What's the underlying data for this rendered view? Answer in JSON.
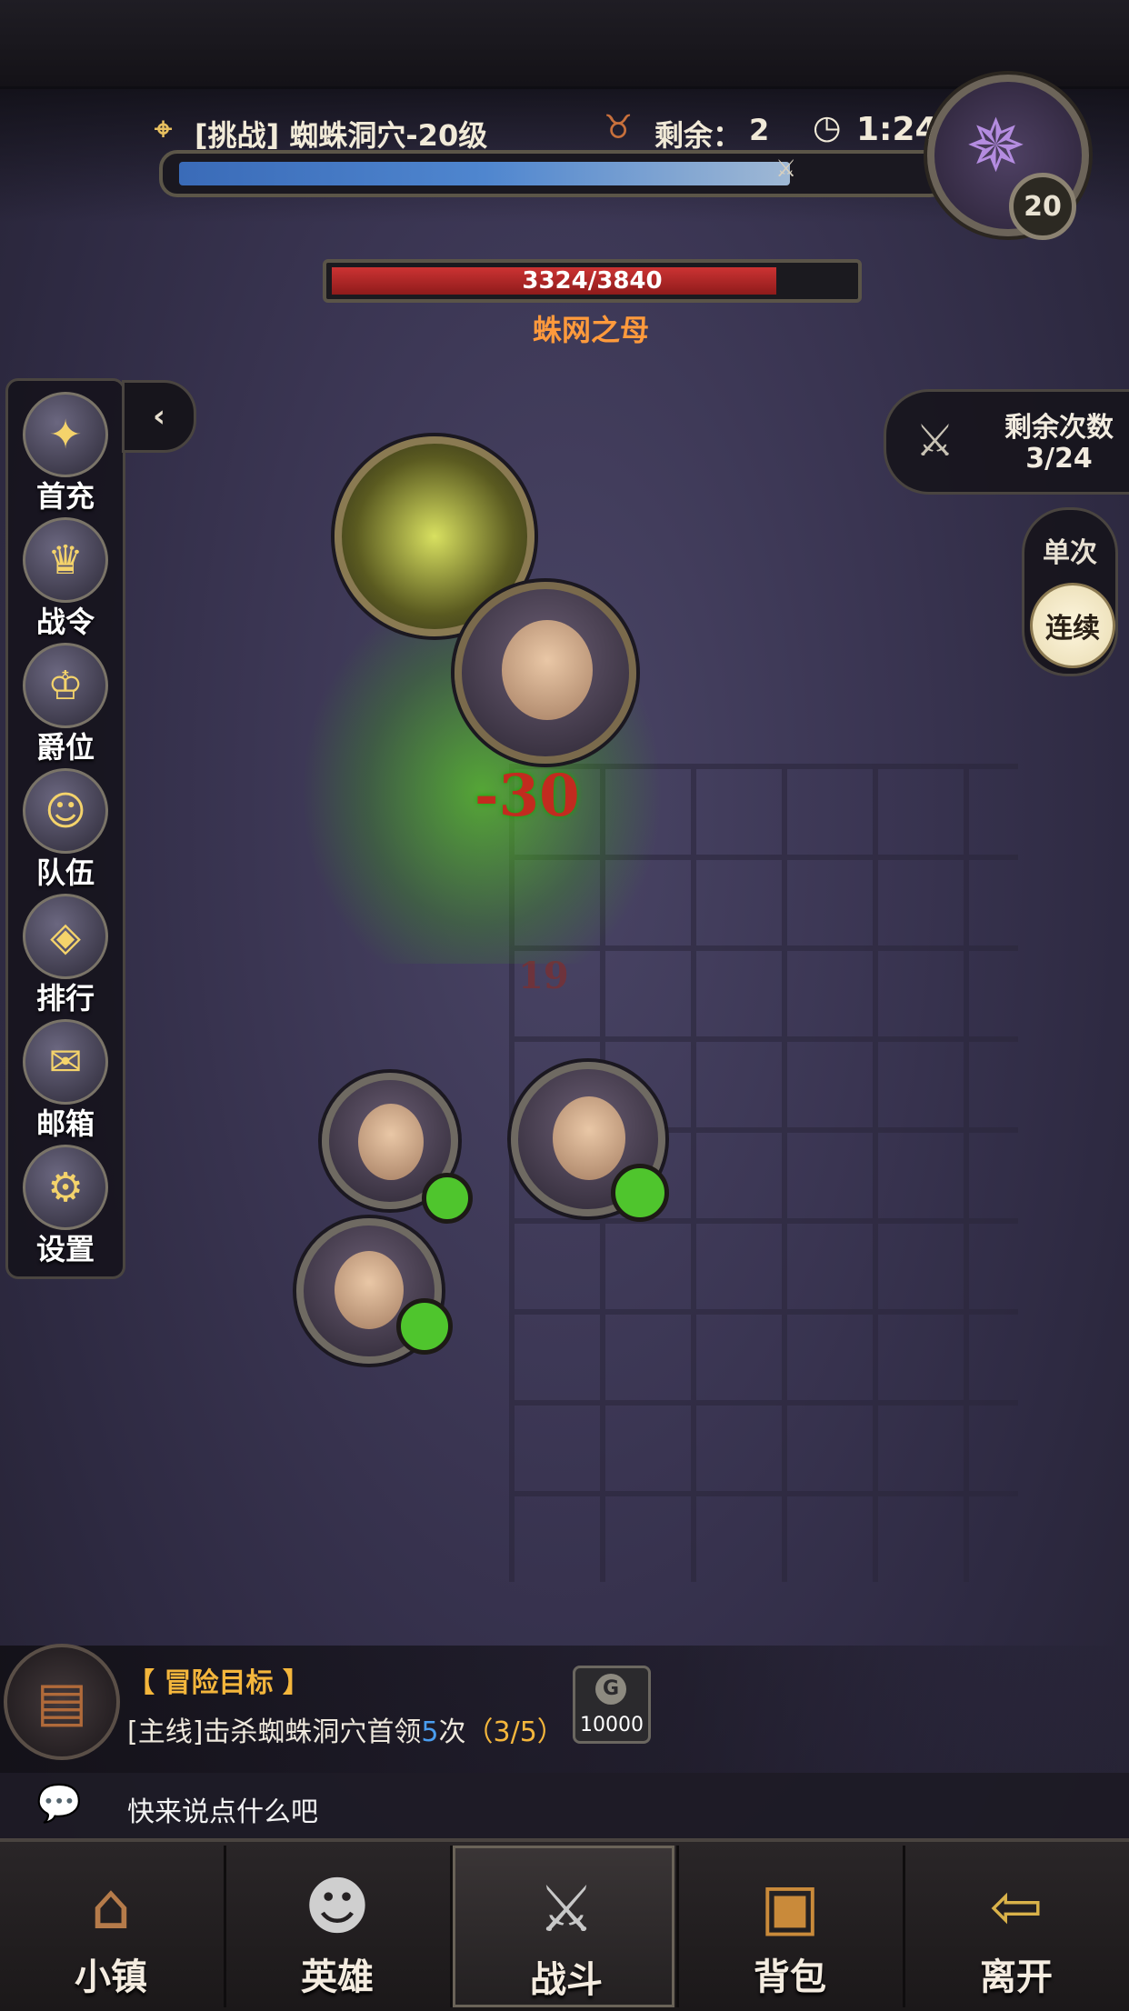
{
  "header": {
    "stage": "[挑战] 蜘蛛洞穴-20级",
    "remaining_label": "剩余：",
    "remaining_value": "2",
    "timer": "1:24",
    "progress_fraction": 0.82,
    "boss_level": "20"
  },
  "boss": {
    "hp_text": "3324/3840",
    "hp_current": 3324,
    "hp_max": 3840,
    "name": "蛛网之母"
  },
  "sidebar": {
    "collapse_icon": "chevron-left-icon",
    "items": [
      {
        "label": "首充",
        "icon": "treasure-chest-icon",
        "glyph": "✦"
      },
      {
        "label": "战令",
        "icon": "winged-crest-icon",
        "glyph": "♛"
      },
      {
        "label": "爵位",
        "icon": "crown-icon",
        "glyph": "♔"
      },
      {
        "label": "队伍",
        "icon": "team-faces-icon",
        "glyph": "☺"
      },
      {
        "label": "排行",
        "icon": "ranking-shield-icon",
        "glyph": "◈"
      },
      {
        "label": "邮箱",
        "icon": "mail-envelope-icon",
        "glyph": "✉"
      },
      {
        "label": "设置",
        "icon": "gear-icon",
        "glyph": "⚙"
      }
    ]
  },
  "right_panel": {
    "remain_times_label": "剩余次数",
    "remain_times_value": "3/24",
    "mode_single": "单次",
    "mode_continuous": "连续"
  },
  "battle": {
    "damage_main": "-30",
    "damage_faded": "19"
  },
  "quest": {
    "title": "【 冒险目标 】",
    "desc_prefix": "[主线]击杀蜘蛛洞穴首领",
    "desc_count": "5",
    "desc_suffix": "次",
    "progress": "（3/5）",
    "reward_amount": "10000"
  },
  "chat": {
    "placeholder": "快来说点什么吧"
  },
  "bottom_nav": [
    {
      "label": "小镇",
      "icon": "town-icon",
      "glyph": "⌂",
      "active": false
    },
    {
      "label": "英雄",
      "icon": "hero-icon",
      "glyph": "☻",
      "active": false
    },
    {
      "label": "战斗",
      "icon": "crossed-swords-icon",
      "glyph": "⚔",
      "active": true
    },
    {
      "label": "背包",
      "icon": "backpack-icon",
      "glyph": "▣",
      "active": false
    },
    {
      "label": "离开",
      "icon": "exit-door-icon",
      "glyph": "⇦",
      "active": false
    }
  ],
  "colors": {
    "accent_orange": "#ff9a3c",
    "damage_red": "#c22b1f",
    "heal_green": "#4fc52d",
    "quest_gold": "#f4b63c",
    "count_blue": "#4a9ef0"
  }
}
